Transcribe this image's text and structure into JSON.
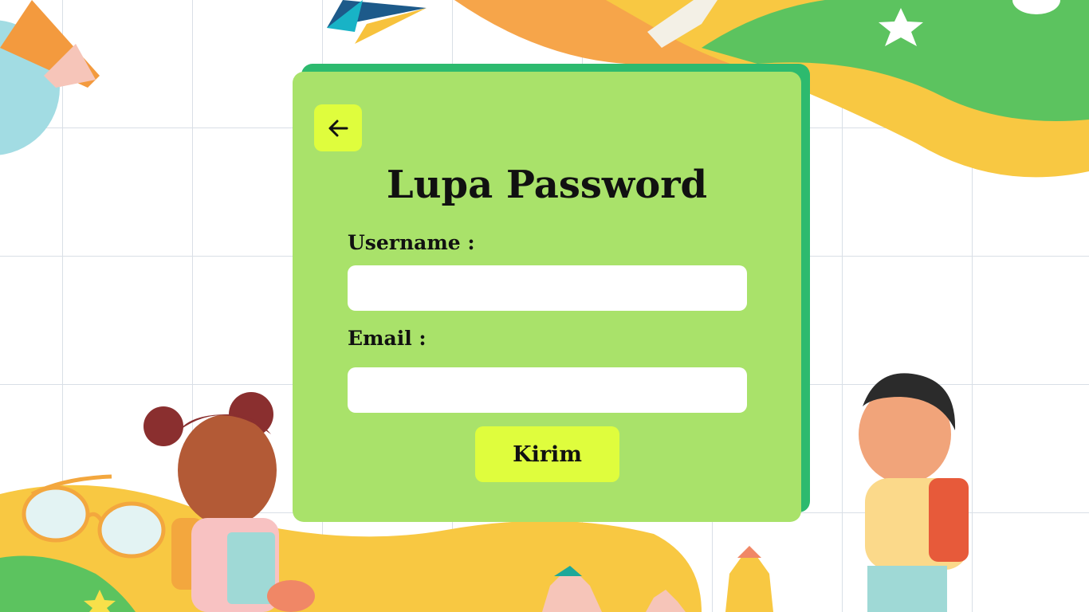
{
  "page": {
    "title": "Lupa Password"
  },
  "form": {
    "username_label": "Username :",
    "username_value": "",
    "email_label": "Email :",
    "email_value": "",
    "submit_label": "Kirim"
  },
  "icons": {
    "back": "arrow-left-icon"
  },
  "colors": {
    "panel": "#a9e26a",
    "panel_shadow": "#2dba6e",
    "button": "#dffd3d",
    "field": "#ffffff"
  }
}
